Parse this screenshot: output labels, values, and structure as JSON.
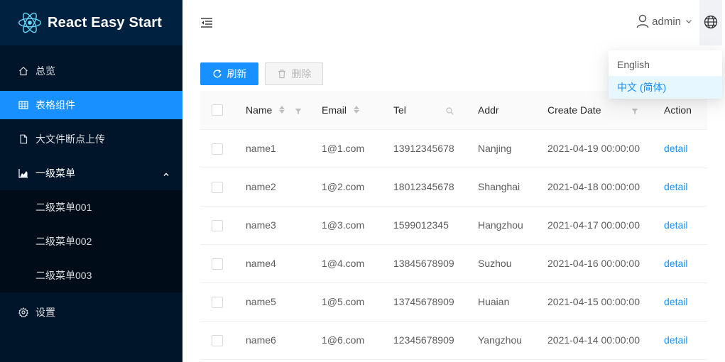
{
  "app": {
    "title": "React Easy Start"
  },
  "sidebar": {
    "items": [
      {
        "label": "总览",
        "icon": "home-icon"
      },
      {
        "label": "表格组件",
        "icon": "table-icon",
        "selected": true
      },
      {
        "label": "大文件断点上传",
        "icon": "file-icon"
      },
      {
        "label": "一级菜单",
        "icon": "area-chart-icon",
        "open": true,
        "children": [
          {
            "label": "二级菜单001"
          },
          {
            "label": "二级菜单002"
          },
          {
            "label": "二级菜单003"
          }
        ]
      },
      {
        "label": "设置",
        "icon": "gear-icon"
      }
    ]
  },
  "header": {
    "username": "admin",
    "language_icon": "globe-icon",
    "collapse_icon": "menu-fold-icon"
  },
  "toolbar": {
    "refresh_label": "刷新",
    "delete_label": "删除"
  },
  "table": {
    "columns": [
      {
        "key": "name",
        "label": "Name"
      },
      {
        "key": "email",
        "label": "Email"
      },
      {
        "key": "tel",
        "label": "Tel"
      },
      {
        "key": "addr",
        "label": "Addr"
      },
      {
        "key": "date",
        "label": "Create Date"
      },
      {
        "key": "action",
        "label": "Action"
      }
    ],
    "rows": [
      {
        "name": "name1",
        "email": "1@1.com",
        "tel": "13912345678",
        "addr": "Nanjing",
        "date": "2021-04-19 00:00:00",
        "action": "detail"
      },
      {
        "name": "name2",
        "email": "1@2.com",
        "tel": "18012345678",
        "addr": "Shanghai",
        "date": "2021-04-18 00:00:00",
        "action": "detail"
      },
      {
        "name": "name3",
        "email": "1@3.com",
        "tel": "1599012345",
        "addr": "Hangzhou",
        "date": "2021-04-17 00:00:00",
        "action": "detail"
      },
      {
        "name": "name4",
        "email": "1@4.com",
        "tel": "13845678909",
        "addr": "Suzhou",
        "date": "2021-04-16 00:00:00",
        "action": "detail"
      },
      {
        "name": "name5",
        "email": "1@5.com",
        "tel": "13745678909",
        "addr": "Huaian",
        "date": "2021-04-15 00:00:00",
        "action": "detail"
      },
      {
        "name": "name6",
        "email": "1@6.com",
        "tel": "12345678909",
        "addr": "Yangzhou",
        "date": "2021-04-14 00:00:00",
        "action": "detail"
      }
    ]
  },
  "language_menu": {
    "options": [
      {
        "label": "English"
      },
      {
        "label": "中文 (简体)",
        "active": true
      }
    ]
  },
  "colors": {
    "primary": "#1890ff",
    "sider_bg": "#001529",
    "sub_menu_bg": "#000c17"
  }
}
